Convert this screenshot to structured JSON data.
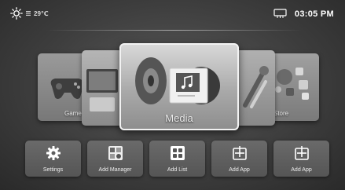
{
  "status": {
    "temperature": "29℃",
    "time": "03:05 PM",
    "icons": [
      "sun-icon",
      "signal-bars-icon",
      "network-icon"
    ]
  },
  "carousel": {
    "items": [
      {
        "label": "Game",
        "icon": "gamepad-icon"
      },
      {
        "label": "",
        "icon": "tv-icon"
      },
      {
        "label": "Media",
        "icon": "music-icon",
        "selected": true
      },
      {
        "label": "",
        "icon": "tools-icon"
      },
      {
        "label": "Store",
        "icon": "apps-icon"
      }
    ]
  },
  "tiles": [
    {
      "label": "Settings",
      "icon": "gear-icon"
    },
    {
      "label": "Add Manager",
      "icon": "photo-grid-icon"
    },
    {
      "label": "Add List",
      "icon": "app-grid-icon"
    },
    {
      "label": "Add App",
      "icon": "add-app-icon"
    },
    {
      "label": "Add App",
      "icon": "add-app-icon"
    }
  ]
}
